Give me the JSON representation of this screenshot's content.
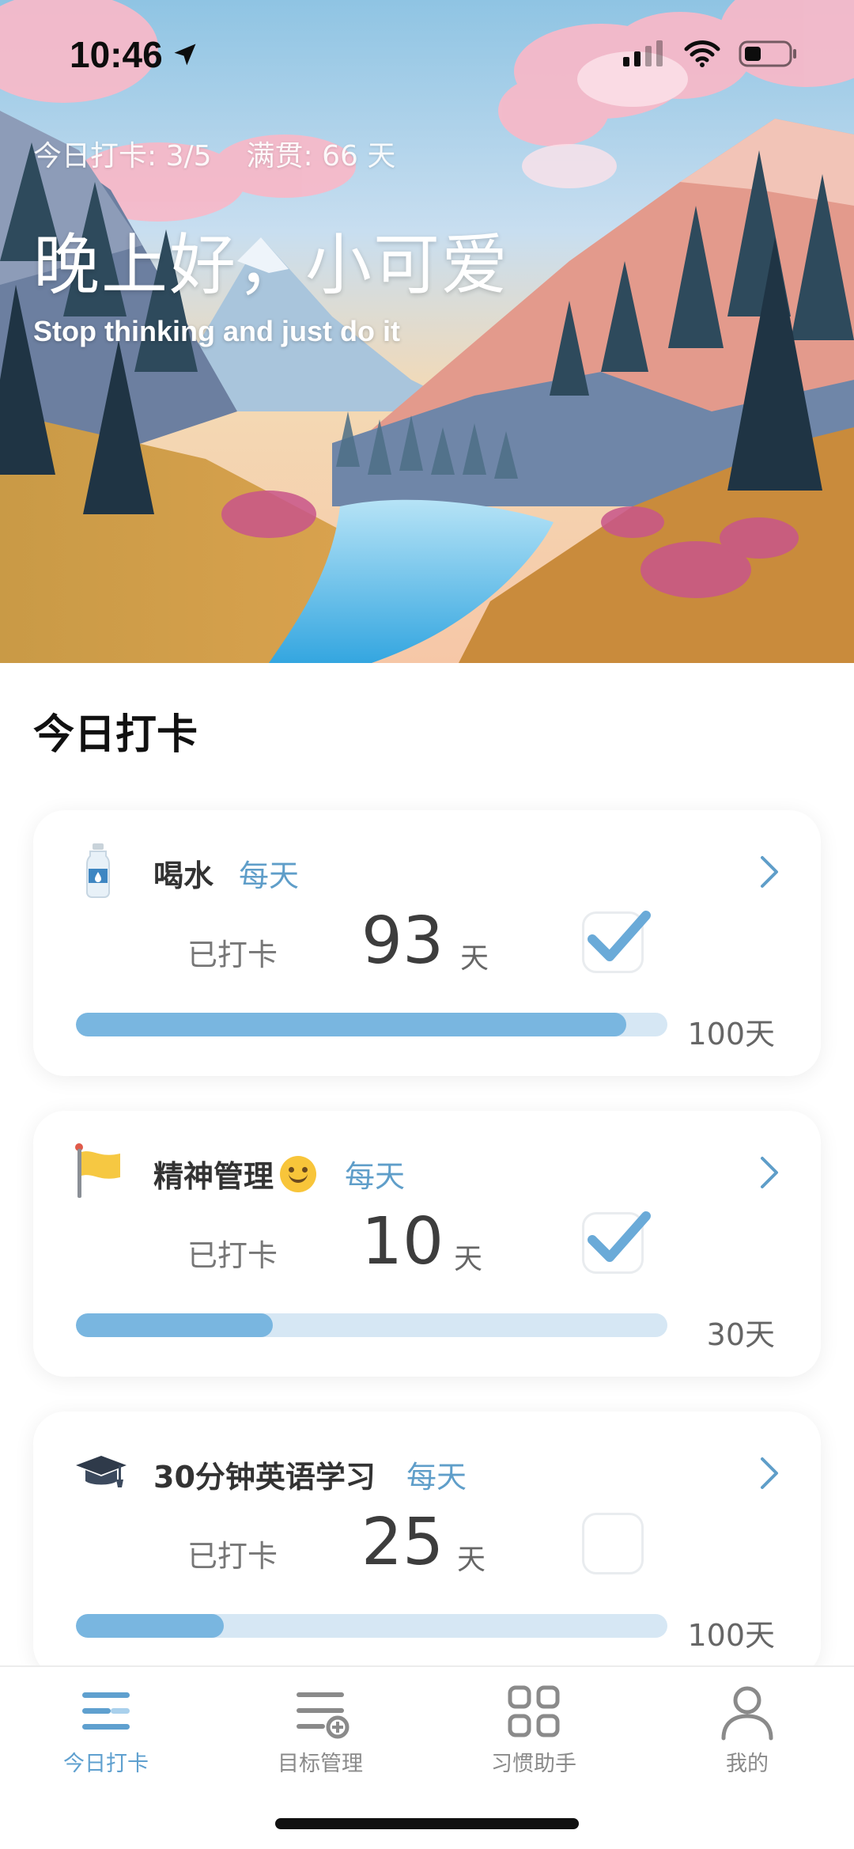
{
  "status": {
    "time": "10:46"
  },
  "hero": {
    "today_checkin": "今日打卡: 3/5",
    "full_streak": "满贯: 66 天",
    "greeting": "晚上好，小可爱",
    "motto": "Stop thinking and just do it"
  },
  "section_title": "今日打卡",
  "habits": [
    {
      "icon": "water-bottle-icon",
      "name": "喝水",
      "emoji": "",
      "frequency": "每天",
      "done_label": "已打卡",
      "count": "93",
      "unit": "天",
      "checked": true,
      "progress": 0.93,
      "target": "100天"
    },
    {
      "icon": "yellow-flag-icon",
      "name": "精神管理",
      "emoji": "😊",
      "frequency": "每天",
      "done_label": "已打卡",
      "count": "10",
      "unit": "天",
      "checked": true,
      "progress": 0.3333,
      "target": "30天"
    },
    {
      "icon": "graduation-cap-icon",
      "name": "30分钟英语学习",
      "emoji": "",
      "frequency": "每天",
      "done_label": "已打卡",
      "count": "25",
      "unit": "天",
      "checked": false,
      "progress": 0.25,
      "target": "100天"
    }
  ],
  "tabs": [
    {
      "label": "今日打卡",
      "icon": "checkin-list-icon",
      "active": true
    },
    {
      "label": "目标管理",
      "icon": "goal-add-icon",
      "active": false
    },
    {
      "label": "习惯助手",
      "icon": "grid-apps-icon",
      "active": false
    },
    {
      "label": "我的",
      "icon": "user-profile-icon",
      "active": false
    }
  ],
  "colors": {
    "accent": "#5fa0cf",
    "progress_fill": "#79b6e0",
    "progress_track": "#d6e7f4",
    "check": "#6aaad8"
  }
}
